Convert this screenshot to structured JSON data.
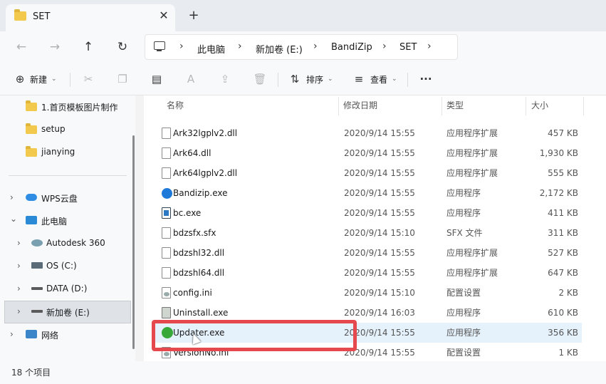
{
  "tab": {
    "title": "SET",
    "close": "✕",
    "new_tab": "+"
  },
  "nav": {
    "back": "←",
    "forward": "→",
    "up": "↑",
    "refresh": "↻"
  },
  "breadcrumb": {
    "sep": "›",
    "items": [
      "此电脑",
      "新加卷 (E:)",
      "BandiZip",
      "SET"
    ]
  },
  "toolbar": {
    "new_label": "新建",
    "sort_label": "排序",
    "view_label": "查看",
    "more": "···"
  },
  "sidebar": {
    "items": [
      {
        "label": "1.首页模板图片制作",
        "icon": "folder-icon"
      },
      {
        "label": "setup",
        "icon": "folder-icon"
      },
      {
        "label": "jianying",
        "icon": "folder-icon"
      },
      {
        "label": "WPS云盘",
        "icon": "cloud-icon"
      },
      {
        "label": "此电脑",
        "icon": "pc-icon"
      },
      {
        "label": "Autodesk 360",
        "icon": "autodesk-icon"
      },
      {
        "label": "OS (C:)",
        "icon": "drive-icon"
      },
      {
        "label": "DATA (D:)",
        "icon": "drive-icon"
      },
      {
        "label": "新加卷 (E:)",
        "icon": "drive-icon"
      },
      {
        "label": "网络",
        "icon": "network-icon"
      }
    ]
  },
  "columns": {
    "name": "名称",
    "date": "修改日期",
    "type": "类型",
    "size": "大小"
  },
  "files": [
    {
      "name": "Ark32lgplv2.dll",
      "date": "2020/9/14 15:55",
      "type": "应用程序扩展",
      "size": "457 KB",
      "icon": "dll-icon"
    },
    {
      "name": "Ark64.dll",
      "date": "2020/9/14 15:55",
      "type": "应用程序扩展",
      "size": "1,930 KB",
      "icon": "dll-icon"
    },
    {
      "name": "Ark64lgplv2.dll",
      "date": "2020/9/14 15:55",
      "type": "应用程序扩展",
      "size": "555 KB",
      "icon": "dll-icon"
    },
    {
      "name": "Bandizip.exe",
      "date": "2020/9/14 15:55",
      "type": "应用程序",
      "size": "2,172 KB",
      "icon": "bandizip-icon"
    },
    {
      "name": "bc.exe",
      "date": "2020/9/14 15:55",
      "type": "应用程序",
      "size": "411 KB",
      "icon": "exe-icon"
    },
    {
      "name": "bdzsfx.sfx",
      "date": "2020/9/14 15:10",
      "type": "SFX 文件",
      "size": "311 KB",
      "icon": "file-icon"
    },
    {
      "name": "bdzshl32.dll",
      "date": "2020/9/14 15:55",
      "type": "应用程序扩展",
      "size": "527 KB",
      "icon": "dll-icon"
    },
    {
      "name": "bdzshl64.dll",
      "date": "2020/9/14 15:55",
      "type": "应用程序扩展",
      "size": "647 KB",
      "icon": "dll-icon"
    },
    {
      "name": "config.ini",
      "date": "2020/9/14 15:10",
      "type": "配置设置",
      "size": "2 KB",
      "icon": "ini-icon"
    },
    {
      "name": "Uninstall.exe",
      "date": "2020/9/14 16:03",
      "type": "应用程序",
      "size": "610 KB",
      "icon": "uninstall-icon"
    },
    {
      "name": "Updater.exe",
      "date": "2020/9/14 15:55",
      "type": "应用程序",
      "size": "356 KB",
      "icon": "updater-icon"
    },
    {
      "name": "VersionNo.ini",
      "date": "2020/9/14 15:55",
      "type": "配置设置",
      "size": "1 KB",
      "icon": "ini-icon"
    }
  ],
  "status": {
    "count": "18 个项目"
  }
}
